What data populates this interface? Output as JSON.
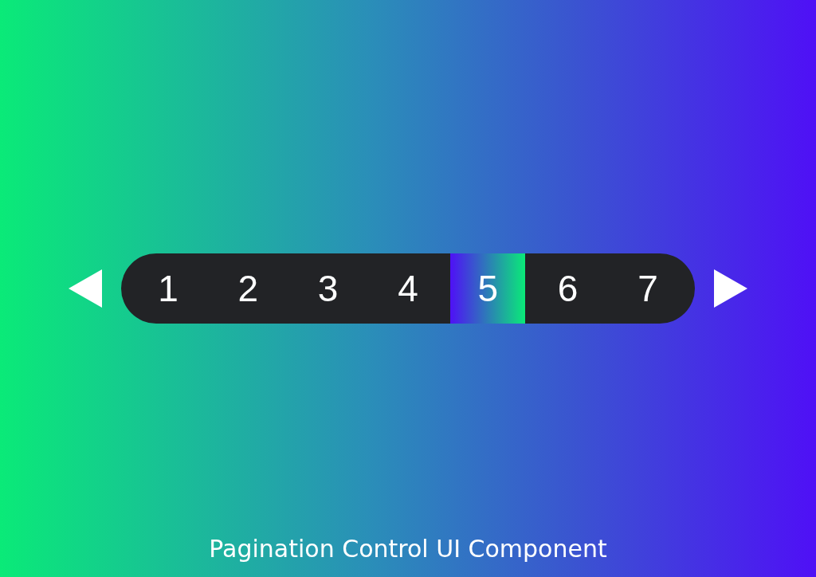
{
  "pagination": {
    "pages": [
      {
        "label": "1",
        "selected": false
      },
      {
        "label": "2",
        "selected": false
      },
      {
        "label": "3",
        "selected": false
      },
      {
        "label": "4",
        "selected": false
      },
      {
        "label": "5",
        "selected": true
      },
      {
        "label": "6",
        "selected": false
      },
      {
        "label": "7",
        "selected": false
      }
    ]
  },
  "caption": "Pagination Control UI Component"
}
